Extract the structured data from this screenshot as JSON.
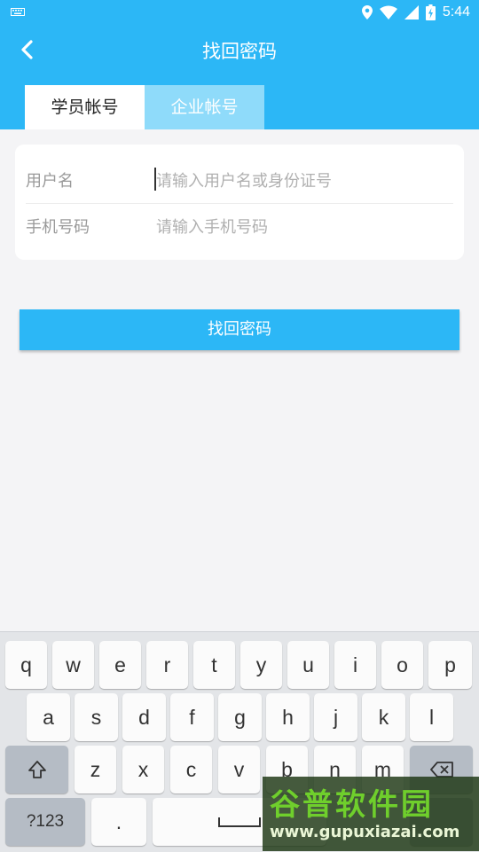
{
  "status_bar": {
    "time": "5:44",
    "icons": [
      "keyboard-indicator-icon",
      "location-icon",
      "wifi-icon",
      "signal-icon",
      "battery-icon"
    ]
  },
  "header": {
    "title": "找回密码",
    "back_icon": "chevron-left-icon",
    "tabs": [
      {
        "label": "学员帐号",
        "active": true
      },
      {
        "label": "企业帐号",
        "active": false
      }
    ]
  },
  "form": {
    "username": {
      "label": "用户名",
      "placeholder": "请输入用户名或身份证号",
      "value": ""
    },
    "phone": {
      "label": "手机号码",
      "placeholder": "请输入手机号码",
      "value": ""
    }
  },
  "submit_label": "找回密码",
  "keyboard": {
    "row1": [
      "q",
      "w",
      "e",
      "r",
      "t",
      "y",
      "u",
      "i",
      "o",
      "p"
    ],
    "row2": [
      "a",
      "s",
      "d",
      "f",
      "g",
      "h",
      "j",
      "k",
      "l"
    ],
    "row3": [
      "z",
      "x",
      "c",
      "v",
      "b",
      "n",
      "m"
    ],
    "shift_icon": "shift-icon",
    "backspace_icon": "backspace-icon",
    "symbols_label": "?123",
    "period_label": ".",
    "space_icon": "space-icon"
  },
  "watermark": {
    "title": "谷普软件园",
    "url": "www.gupuxiazai.com"
  },
  "colors": {
    "primary": "#2cb7f6",
    "tab_inactive": "#8fdbfa",
    "background": "#f4f4f6"
  }
}
